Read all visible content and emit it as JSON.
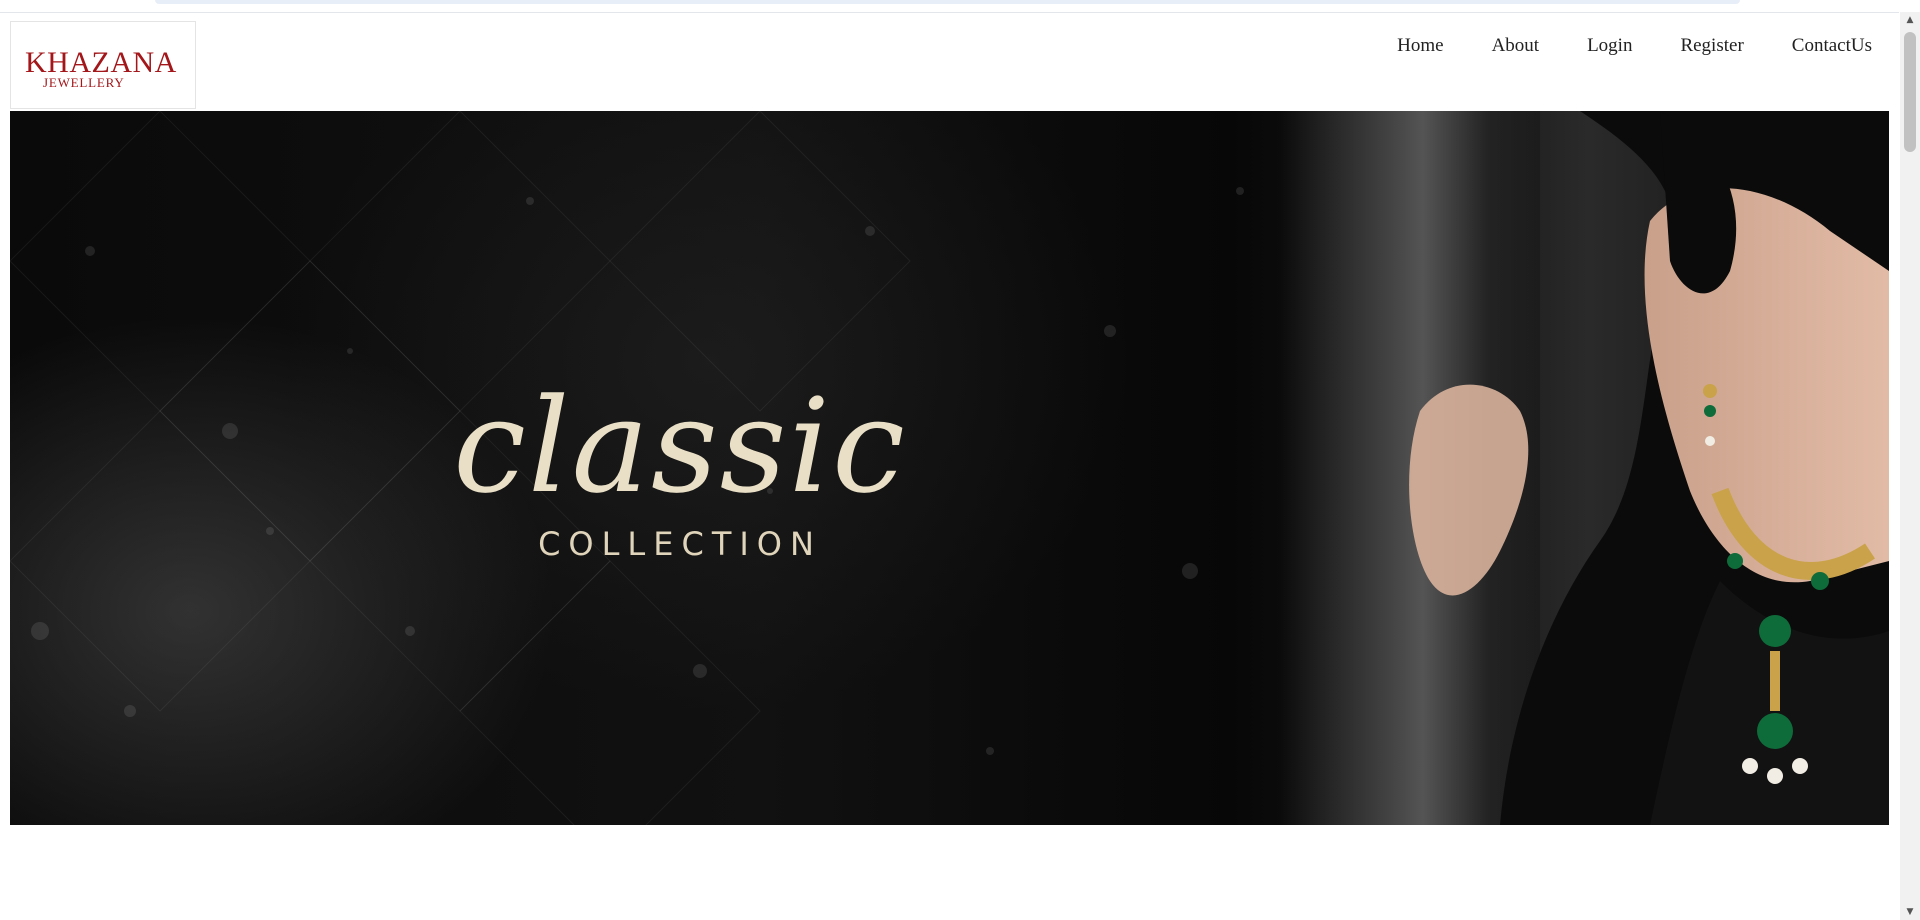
{
  "brand": {
    "logo_main": "KHAZANA",
    "logo_sub": "JEWELLERY",
    "color": "#a3161a"
  },
  "nav": {
    "items": [
      {
        "label": "Home"
      },
      {
        "label": "About"
      },
      {
        "label": "Login"
      },
      {
        "label": "Register"
      },
      {
        "label": "ContactUs"
      }
    ]
  },
  "hero": {
    "headline": "classic",
    "subheadline": "COLLECTION",
    "text_color": "#e9dfc6"
  },
  "scrollbar": {
    "up_icon": "scroll-up-arrow",
    "down_icon": "scroll-down-arrow"
  }
}
